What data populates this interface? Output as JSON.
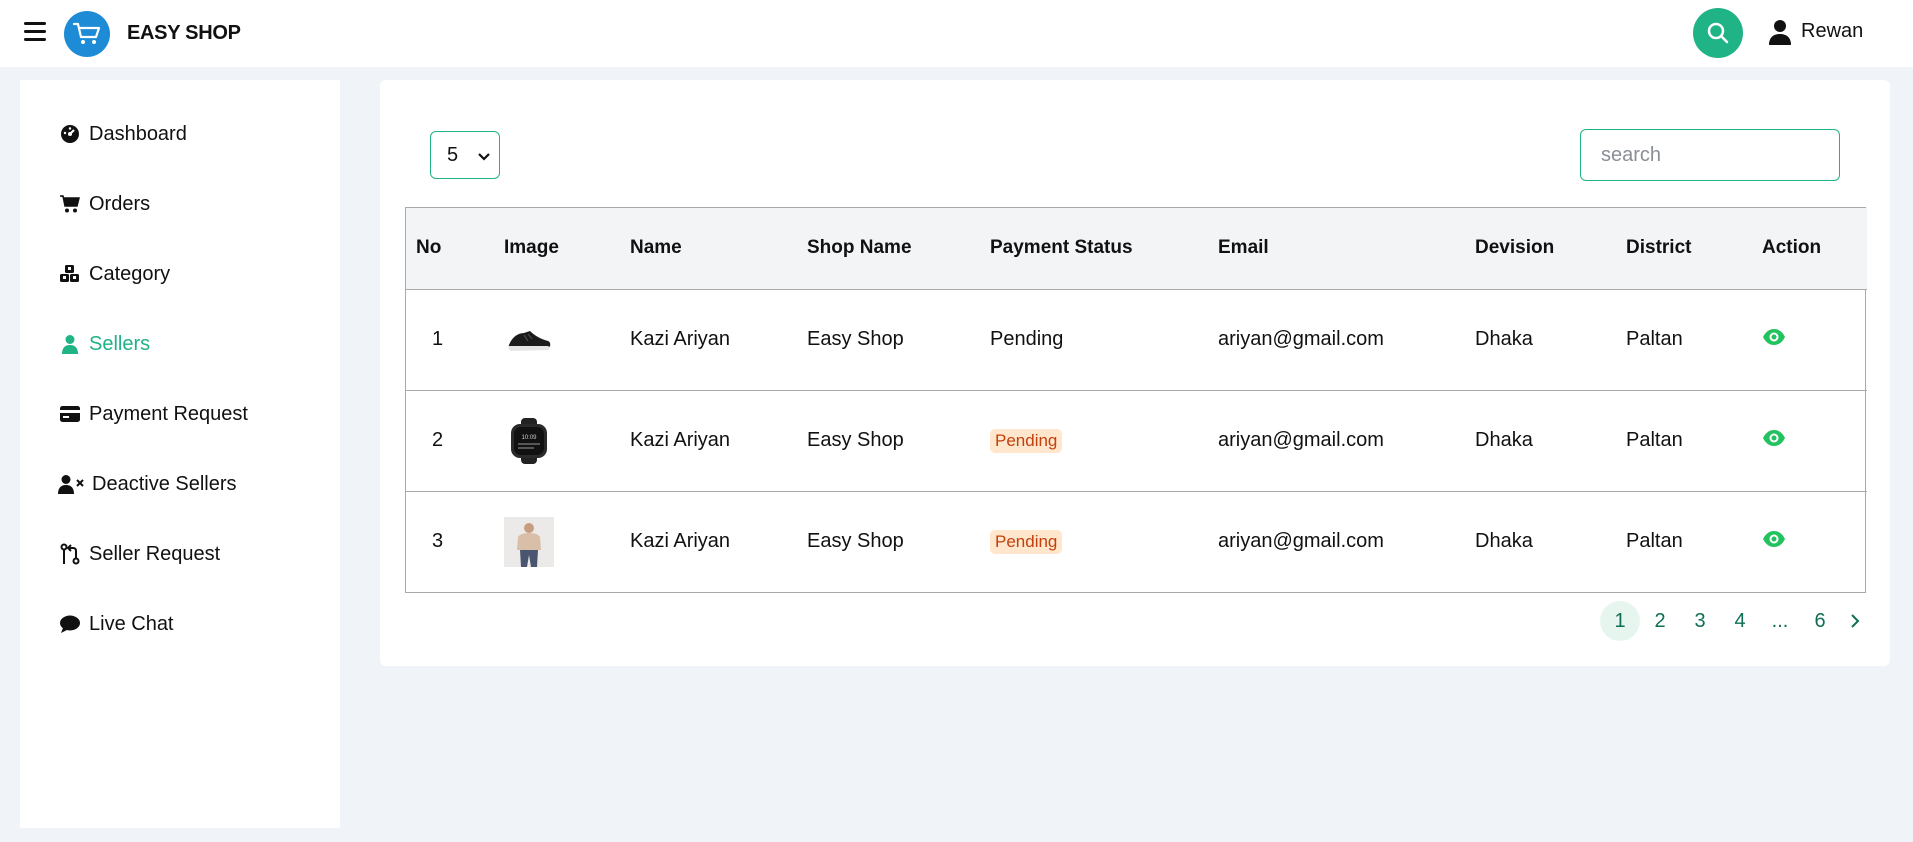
{
  "app": {
    "brand": "EASY SHOP"
  },
  "header": {
    "user_name": "Rewan"
  },
  "sidebar": {
    "items": [
      {
        "label": "Dashboard",
        "icon": "dashboard-icon",
        "active": false
      },
      {
        "label": "Orders",
        "icon": "cart-icon",
        "active": false
      },
      {
        "label": "Category",
        "icon": "cubes-icon",
        "active": false
      },
      {
        "label": "Sellers",
        "icon": "user-icon",
        "active": true
      },
      {
        "label": "Payment Request",
        "icon": "credit-card-icon",
        "active": false
      },
      {
        "label": "Deactive Sellers",
        "icon": "user-x-icon",
        "active": false
      },
      {
        "label": "Seller Request",
        "icon": "git-pull-request-icon",
        "active": false
      },
      {
        "label": "Live Chat",
        "icon": "chat-bubble-icon",
        "active": false
      }
    ]
  },
  "controls": {
    "per_page": "5",
    "search_placeholder": "search"
  },
  "table": {
    "headers": [
      "No",
      "Image",
      "Name",
      "Shop Name",
      "Payment Status",
      "Email",
      "Devision",
      "District",
      "Action"
    ],
    "rows": [
      {
        "no": "1",
        "image": "sneaker-image",
        "name": "Kazi Ariyan",
        "shop": "Easy Shop",
        "status": "Pending",
        "status_badge": false,
        "email": "ariyan@gmail.com",
        "division": "Dhaka",
        "district": "Paltan"
      },
      {
        "no": "2",
        "image": "smartwatch-image",
        "name": "Kazi Ariyan",
        "shop": "Easy Shop",
        "status": "Pending",
        "status_badge": true,
        "email": "ariyan@gmail.com",
        "division": "Dhaka",
        "district": "Paltan"
      },
      {
        "no": "3",
        "image": "person-image",
        "name": "Kazi Ariyan",
        "shop": "Easy Shop",
        "status": "Pending",
        "status_badge": true,
        "email": "ariyan@gmail.com",
        "division": "Dhaka",
        "district": "Paltan"
      }
    ]
  },
  "pagination": {
    "pages": [
      "1",
      "2",
      "3",
      "4",
      "...",
      "6"
    ],
    "current": "1"
  },
  "colors": {
    "accent": "#1fb385",
    "brand_blue": "#1d8bd6",
    "badge_bg": "#ffe6cc",
    "badge_text": "#c2410c",
    "background": "#f0f3f7"
  }
}
